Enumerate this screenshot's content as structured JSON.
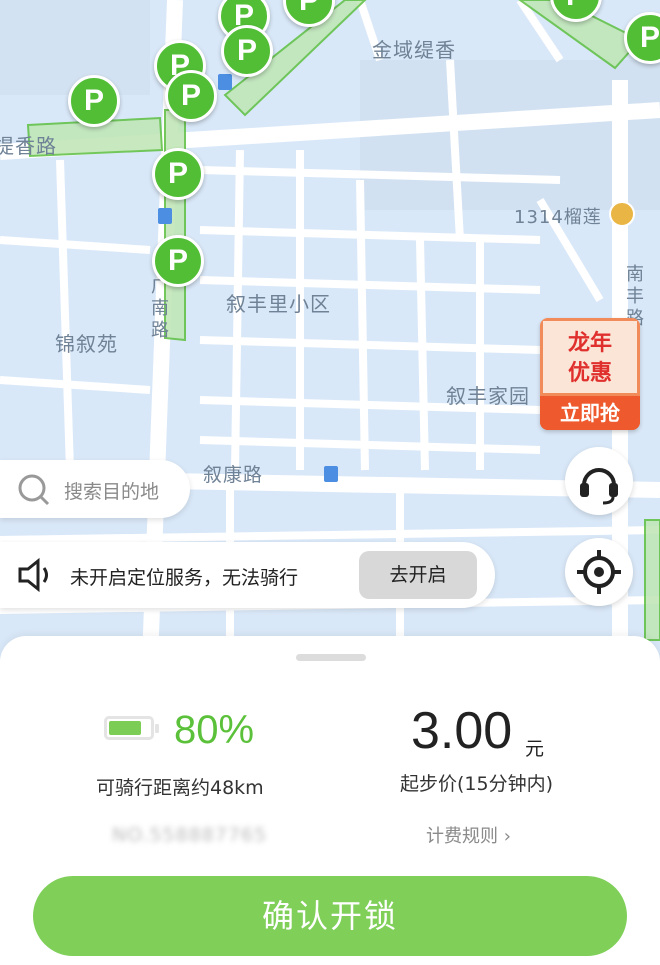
{
  "map": {
    "labels": {
      "jinyu": "金域缇香",
      "tixiang_road": "提香路",
      "durian": "1314榴莲",
      "xufengli": "叙丰里小区",
      "jinxuyuan": "锦叙苑",
      "xufeng_home": "叙丰家园",
      "xukang_road": "叙康路",
      "guangnan_road": "广南路",
      "nanfeng_road": "南丰路"
    },
    "pin_letter": "P"
  },
  "promo": {
    "line1": "龙年",
    "line2": "优惠",
    "button": "立即抢"
  },
  "search": {
    "placeholder": "搜索目的地"
  },
  "location_notice": {
    "text": "未开启定位服务，无法骑行",
    "button": "去开启"
  },
  "vehicle": {
    "battery_percent": "80%",
    "range_text": "可骑行距离约48km",
    "vehicle_code": "NO.558887765",
    "battery_fill": 0.8
  },
  "pricing": {
    "price": "3.00",
    "unit": "元",
    "start_text": "起步价(15分钟内)",
    "rules_link": "计费规则 ›"
  },
  "confirm_button": "确认开锁",
  "colors": {
    "accent": "#5cc13a",
    "button": "#7fcf59",
    "map_bg": "#d9e8f8"
  }
}
